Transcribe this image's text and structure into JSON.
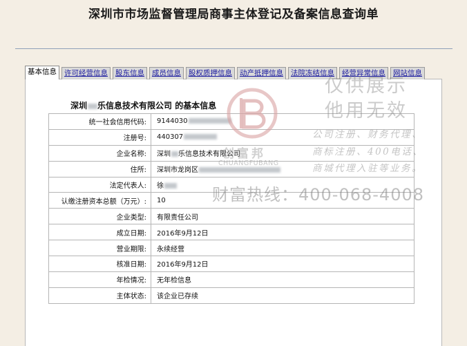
{
  "page": {
    "title": "深圳市市场监督管理局商事主体登记及备案信息查询单"
  },
  "tabs": [
    {
      "label": "基本信息",
      "active": true
    },
    {
      "label": "许可经营信息",
      "active": false
    },
    {
      "label": "股东信息",
      "active": false
    },
    {
      "label": "成员信息",
      "active": false
    },
    {
      "label": "股权质押信息",
      "active": false
    },
    {
      "label": "动产抵押信息",
      "active": false
    },
    {
      "label": "法院冻结信息",
      "active": false
    },
    {
      "label": "经营异常信息",
      "active": false
    },
    {
      "label": "网站信息",
      "active": false
    }
  ],
  "company": {
    "name_prefix": "深圳",
    "name_suffix": "乐信息技术有限公司",
    "heading_tail": " 的基本信息"
  },
  "fields": {
    "credit_code": {
      "label": "统一社会信用代码:",
      "value": "9144030"
    },
    "reg_no": {
      "label": "注册号:",
      "value": "440307"
    },
    "company_name": {
      "label": "企业名称:",
      "prefix": "深圳",
      "suffix": "乐信息技术有限公司"
    },
    "address": {
      "label": "住所:",
      "value": "深圳市龙岗区"
    },
    "legal_rep": {
      "label": "法定代表人:",
      "value": "徐"
    },
    "capital": {
      "label": "认缴注册资本总额（万元）:",
      "value": "10"
    },
    "type": {
      "label": "企业类型:",
      "value": "有限责任公司"
    },
    "established": {
      "label": "成立日期:",
      "value": "2016年9月12日"
    },
    "term": {
      "label": "营业期限:",
      "value": "永续经营"
    },
    "approved": {
      "label": "核准日期:",
      "value": "2016年9月12日"
    },
    "annual_check": {
      "label": "年检情况:",
      "value": "无年检信息"
    },
    "status": {
      "label": "主体状态:",
      "value": "该企业已存续"
    }
  },
  "watermark": {
    "brand_cn": "创富邦",
    "brand_en": "CHUANGFUBANG",
    "line1": "仅供展示",
    "line2": "他用无效",
    "services1": "公司注册、财务代理、",
    "services2": "商标注册、400电话、",
    "services3": "商城代理入驻等业务。",
    "hotline": "财富热线：400-068-4008",
    "seal_color": "#d8a0a0"
  }
}
